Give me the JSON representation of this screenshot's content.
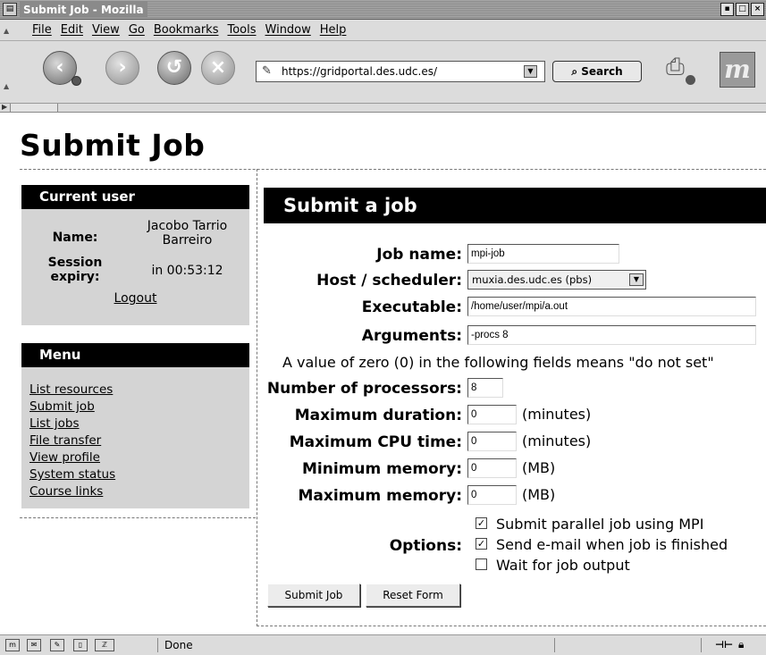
{
  "window": {
    "title": "Submit Job - Mozilla",
    "icon": "app-icon",
    "controls": [
      "minimize-icon",
      "maximize-icon",
      "close-icon"
    ]
  },
  "menubar": {
    "items": [
      "File",
      "Edit",
      "View",
      "Go",
      "Bookmarks",
      "Tools",
      "Window",
      "Help"
    ]
  },
  "navigation": {
    "back_icon": "back-arrow-icon",
    "forward_icon": "forward-arrow-icon",
    "reload_icon": "reload-icon",
    "stop_icon": "stop-icon",
    "url": "https://gridportal.des.udc.es/",
    "search_label": "Search",
    "print_icon": "print-icon",
    "logo_text": "m"
  },
  "page": {
    "title": "Submit Job"
  },
  "sidebar": {
    "current_user": {
      "header": "Current user",
      "name_label": "Name:",
      "name_value_1": "Jacobo Tarrio",
      "name_value_2": "Barreiro",
      "session_label_1": "Session",
      "session_label_2": "expiry:",
      "session_value": "in 00:53:12",
      "logout": "Logout"
    },
    "menu": {
      "header": "Menu",
      "items": [
        "List resources",
        "Submit job",
        "List jobs",
        "File transfer",
        "View profile",
        "System status",
        "Course links"
      ]
    }
  },
  "form": {
    "header": "Submit a job",
    "job_name_label": "Job name:",
    "job_name_value": "mpi-job",
    "host_label": "Host / scheduler:",
    "host_value": "muxia.des.udc.es (pbs)",
    "executable_label": "Executable:",
    "executable_value": "/home/user/mpi/a.out",
    "arguments_label": "Arguments:",
    "arguments_value": "-procs 8",
    "note": "A value of zero (0) in the following fields means \"do not set\"",
    "processors_label": "Number of processors:",
    "processors_value": "8",
    "max_duration_label": "Maximum duration:",
    "max_duration_value": "0",
    "max_duration_unit": "(minutes)",
    "max_cpu_label": "Maximum CPU time:",
    "max_cpu_value": "0",
    "max_cpu_unit": "(minutes)",
    "min_memory_label": "Minimum memory:",
    "min_memory_value": "0",
    "min_memory_unit": "(MB)",
    "max_memory_label": "Maximum memory:",
    "max_memory_value": "0",
    "max_memory_unit": "(MB)",
    "options_label": "Options:",
    "options": [
      {
        "label": "Submit parallel job using MPI",
        "checked": true
      },
      {
        "label": "Send e-mail when job is finished",
        "checked": true
      },
      {
        "label": "Wait for job output",
        "checked": false
      }
    ],
    "submit_label": "Submit Job",
    "reset_label": "Reset Form"
  },
  "statusbar": {
    "status_text": "Done",
    "icons": [
      "mozilla-icon",
      "mail-icon",
      "composer-icon",
      "addressbook-icon",
      "irc-icon",
      "connection-icon",
      "lock-icon"
    ]
  }
}
